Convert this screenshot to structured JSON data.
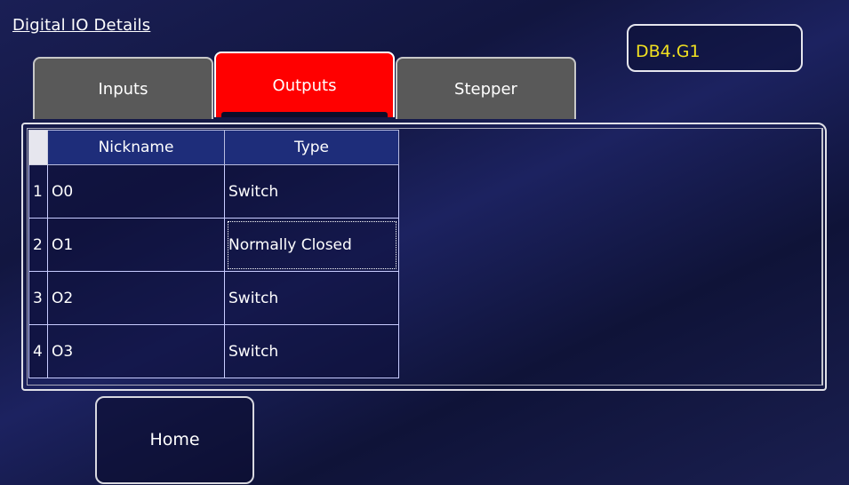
{
  "header": {
    "title": "Digital IO Details",
    "device_id": "DB4.G1"
  },
  "tabs": [
    {
      "label": "Inputs",
      "active": false
    },
    {
      "label": "Outputs",
      "active": true
    },
    {
      "label": "Stepper",
      "active": false
    }
  ],
  "table": {
    "columns": [
      "Nickname",
      "Type"
    ],
    "rows": [
      {
        "num": "1",
        "nickname": "O0",
        "type": "Switch"
      },
      {
        "num": "2",
        "nickname": "O1",
        "type": "Normally Closed"
      },
      {
        "num": "3",
        "nickname": "O2",
        "type": "Switch"
      },
      {
        "num": "4",
        "nickname": "O3",
        "type": "Switch"
      }
    ]
  },
  "footer": {
    "home_label": "Home"
  },
  "colors": {
    "active_tab": "#ff0000",
    "inactive_tab": "#595959",
    "device_text": "#f0e020",
    "header_row": "#1e2d7a"
  }
}
